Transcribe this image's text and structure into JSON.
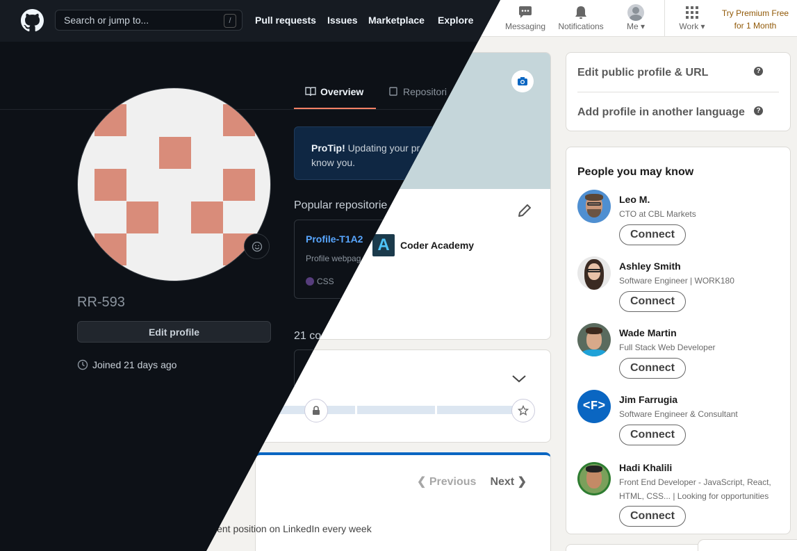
{
  "linkedin": {
    "nav": {
      "messaging": "Messaging",
      "notifications": "Notifications",
      "me": "Me",
      "work": "Work",
      "premium_line1": "Try Premium Free",
      "premium_line2": "for 1 Month"
    },
    "profile_links": {
      "edit_public_profile": "Edit public profile & URL",
      "add_language": "Add profile in another language"
    },
    "school": "Coder Academy",
    "people_title": "People you may know",
    "connect_label": "Connect",
    "people": [
      {
        "name": "Leo M.",
        "headline": "CTO at CBL Markets"
      },
      {
        "name": "Ashley Smith",
        "headline": "Software Engineer | WORK180"
      },
      {
        "name": "Wade Martin",
        "headline": "Full Stack Web Developer"
      },
      {
        "name": "Jim Farrugia",
        "headline": "Software Engineer & Consultant"
      },
      {
        "name": "Hadi Khalili",
        "headline_line1": "Front End Developer - JavaScript, React,",
        "headline_line2": "HTML, CSS... | Looking for opportunities"
      }
    ],
    "pager": {
      "previous": "Previous",
      "next": "Next"
    },
    "suggestion_text": "current position on LinkedIn every week",
    "colors": {
      "premium": "#915907",
      "connect_border": "#666666",
      "banner": "#c5d6da",
      "accent_blue": "#0a66c2"
    }
  },
  "github": {
    "search_placeholder": "Search or jump to...",
    "search_key": "/",
    "nav": [
      "Pull requests",
      "Issues",
      "Marketplace",
      "Explore"
    ],
    "tabs": {
      "overview": "Overview",
      "repositories": "Repositori"
    },
    "username": "RR-593",
    "edit_profile": "Edit profile",
    "joined": "Joined 21 days ago",
    "protip_bold": "ProTip!",
    "protip_text": " Updating your pr",
    "protip_line2": "know you.",
    "popular_title": "Popular repositorie",
    "repo": {
      "name": "Profile-T1A2",
      "desc": "Profile webpag",
      "language": "CSS"
    },
    "contrib_title": "21 co",
    "colors": {
      "background": "#0d1117",
      "link": "#58a6ff",
      "tab_underline": "#f78166",
      "identicon": "#d98c7a",
      "css_dot": "#563d7c"
    }
  }
}
